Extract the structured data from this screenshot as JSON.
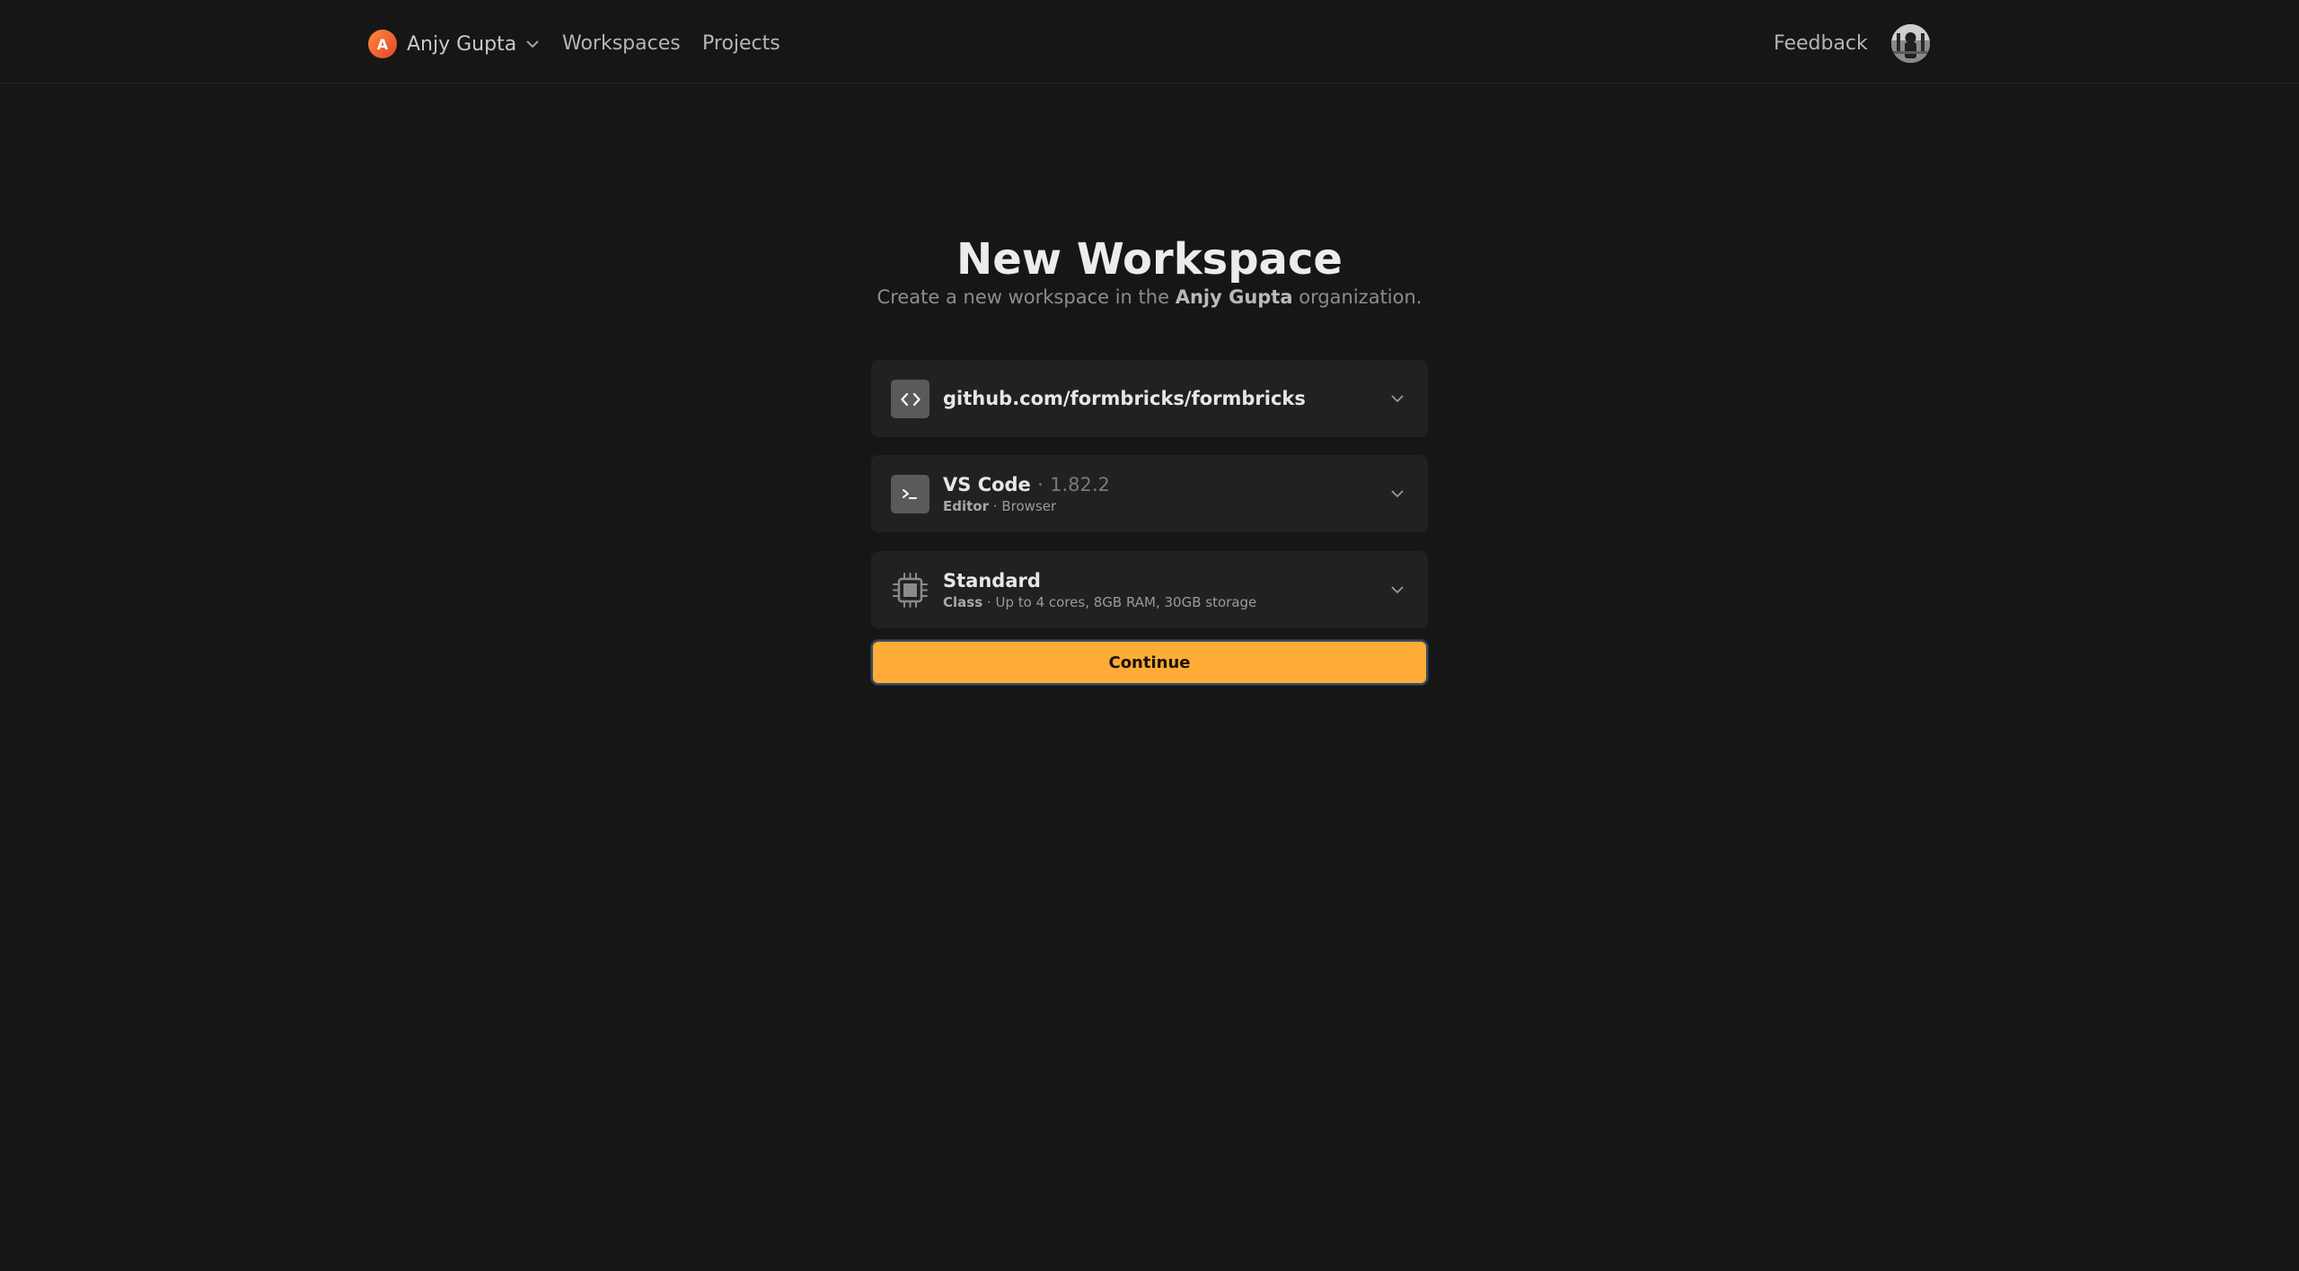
{
  "header": {
    "org_initial": "A",
    "org_name": "Anjy Gupta",
    "nav": {
      "workspaces": "Workspaces",
      "projects": "Projects",
      "feedback": "Feedback"
    }
  },
  "main": {
    "title": "New Workspace",
    "subtitle_prefix": "Create a new workspace in the",
    "subtitle_org": "Anjy Gupta",
    "subtitle_suffix": "organization."
  },
  "repo_selector": {
    "icon": "code-brackets-icon",
    "value": "github.com/formbricks/formbricks"
  },
  "editor_selector": {
    "icon": "terminal-icon",
    "name": "VS Code",
    "separator": "·",
    "version": "1.82.2",
    "type_label": "Editor",
    "type_value": "Browser"
  },
  "class_selector": {
    "icon": "cpu-chip-icon",
    "name": "Standard",
    "type_label": "Class",
    "type_value": "Up to 4 cores, 8GB RAM, 30GB storage"
  },
  "continue_label": "Continue",
  "colors": {
    "background": "#161616",
    "card": "#222120",
    "accent": "#ffab37",
    "org_avatar": "#f0652f"
  }
}
